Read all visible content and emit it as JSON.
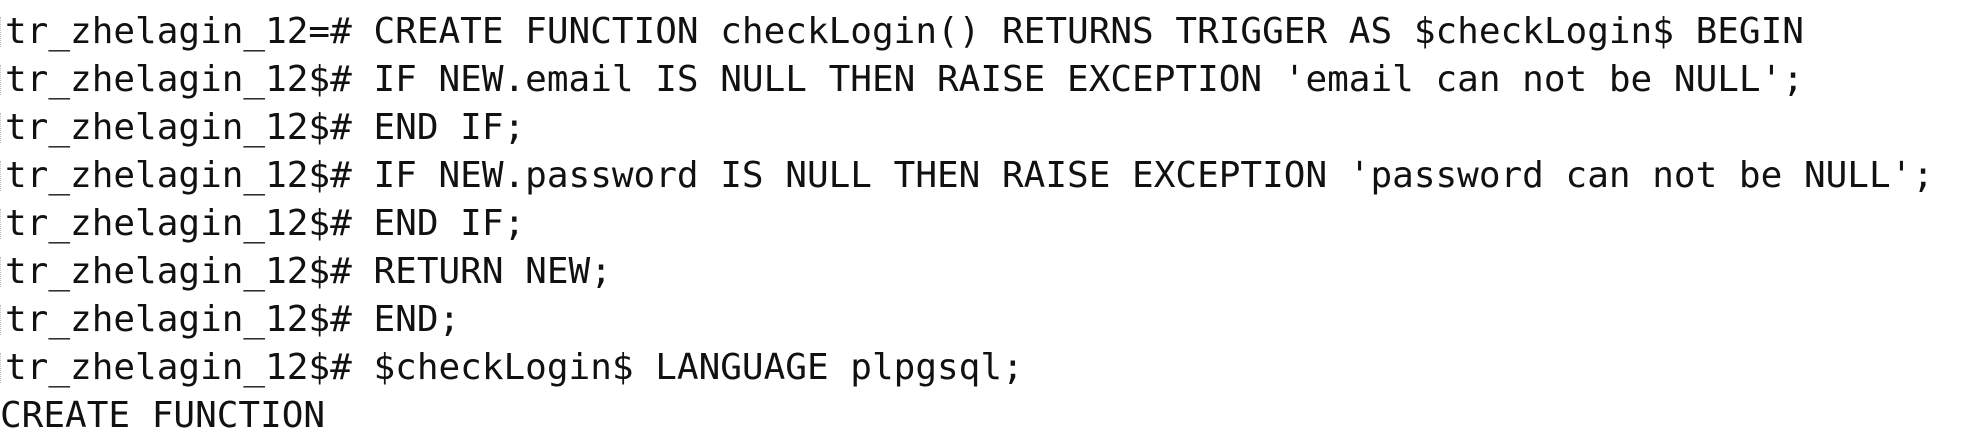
{
  "terminal": {
    "lines": [
      {
        "prompt": "tr_zhelagin_12=# ",
        "text": "CREATE FUNCTION checkLogin() RETURNS TRIGGER AS $checkLogin$ BEGIN"
      },
      {
        "prompt": "tr_zhelagin_12$# ",
        "text": "IF NEW.email IS NULL THEN RAISE EXCEPTION 'email can not be NULL';"
      },
      {
        "prompt": "tr_zhelagin_12$# ",
        "text": "END IF;"
      },
      {
        "prompt": "tr_zhelagin_12$# ",
        "text": "IF NEW.password IS NULL THEN RAISE EXCEPTION 'password can not be NULL';"
      },
      {
        "prompt": "tr_zhelagin_12$# ",
        "text": "END IF;"
      },
      {
        "prompt": "tr_zhelagin_12$# ",
        "text": "RETURN NEW;"
      },
      {
        "prompt": "tr_zhelagin_12$# ",
        "text": "END;"
      },
      {
        "prompt": "tr_zhelagin_12$# ",
        "text": "$checkLogin$ LANGUAGE plpgsql;"
      }
    ],
    "result": "CREATE FUNCTION"
  }
}
